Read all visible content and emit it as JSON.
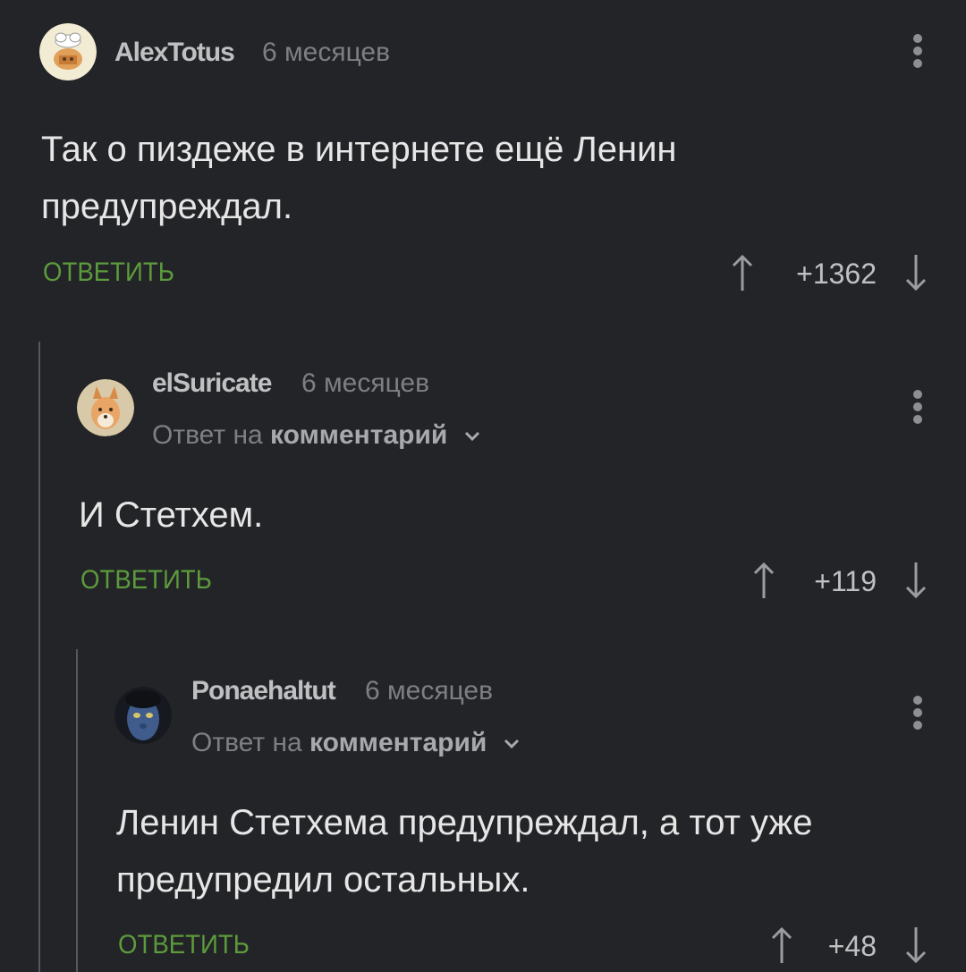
{
  "comments": [
    {
      "username": "AlexTotus",
      "time": "6 месяцев",
      "reply_prefix": "",
      "reply_link": "",
      "text_line1": "Так о пиздеже в интернете ещё Ленин",
      "text_line2": "предупреждал.",
      "reply_button": "ОТВЕТИТЬ",
      "rating": "+1362"
    },
    {
      "username": "elSuricate",
      "time": "6 месяцев",
      "reply_prefix": "Ответ на",
      "reply_link": "комментарий",
      "text_line1": "И Стетхем.",
      "text_line2": "",
      "reply_button": "ОТВЕТИТЬ",
      "rating": "+119"
    },
    {
      "username": "Ponaehaltut",
      "time": "6 месяцев",
      "reply_prefix": "Ответ на",
      "reply_link": "комментарий",
      "text_line1": "Ленин Стетхема предупреждал, а тот уже",
      "text_line2": "предупредил остальных.",
      "reply_button": "ОТВЕТИТЬ",
      "rating": "+48"
    }
  ],
  "colors": {
    "background": "#232427",
    "reply_green": "#5c9b3c",
    "username": "#bfc0c2",
    "muted": "#7d7f83",
    "thread_line": "#55575c"
  }
}
